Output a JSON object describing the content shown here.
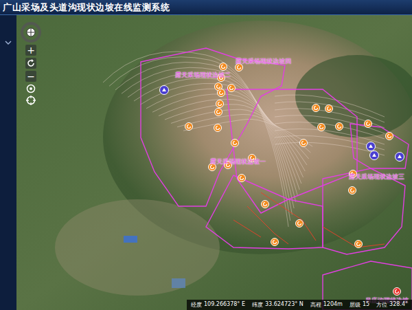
{
  "window": {
    "title": "广山采场及头道沟现状边坡在线监测系统"
  },
  "nav": {
    "zoom_in": "+",
    "zoom_out": "−"
  },
  "map": {
    "labels": [
      {
        "text": "露天采场现状边坡四"
      },
      {
        "text": "露天采场现状边坡二"
      },
      {
        "text": "露天采场现状边坡一"
      },
      {
        "text": "露天采场现状边坡三"
      },
      {
        "text": "吊庄沟现状边坡"
      }
    ],
    "pins": [
      {
        "kind": "monitor",
        "color": "#f28a1e"
      },
      {
        "kind": "monitor",
        "color": "#f28a1e"
      },
      {
        "kind": "monitor",
        "color": "#f28a1e"
      },
      {
        "kind": "monitor",
        "color": "#f28a1e"
      },
      {
        "kind": "monitor",
        "color": "#f28a1e"
      },
      {
        "kind": "monitor",
        "color": "#f28a1e"
      },
      {
        "kind": "monitor",
        "color": "#f28a1e"
      },
      {
        "kind": "monitor",
        "color": "#f28a1e"
      },
      {
        "kind": "monitor",
        "color": "#f28a1e"
      },
      {
        "kind": "monitor",
        "color": "#f28a1e"
      },
      {
        "kind": "monitor",
        "color": "#f28a1e"
      },
      {
        "kind": "monitor",
        "color": "#f28a1e"
      },
      {
        "kind": "monitor",
        "color": "#f28a1e"
      },
      {
        "kind": "monitor",
        "color": "#f28a1e"
      },
      {
        "kind": "monitor",
        "color": "#f28a1e"
      },
      {
        "kind": "monitor",
        "color": "#f28a1e"
      },
      {
        "kind": "monitor",
        "color": "#f28a1e"
      },
      {
        "kind": "monitor",
        "color": "#f28a1e"
      },
      {
        "kind": "monitor",
        "color": "#f28a1e"
      },
      {
        "kind": "monitor",
        "color": "#f28a1e"
      },
      {
        "kind": "monitor",
        "color": "#f28a1e"
      },
      {
        "kind": "monitor",
        "color": "#f28a1e"
      },
      {
        "kind": "monitor",
        "color": "#f28a1e"
      },
      {
        "kind": "monitor",
        "color": "#f28a1e"
      },
      {
        "kind": "monitor",
        "color": "#f28a1e"
      },
      {
        "kind": "monitor",
        "color": "#f28a1e"
      },
      {
        "kind": "monitor",
        "color": "#f28a1e"
      },
      {
        "kind": "monitor",
        "color": "#f28a1e"
      },
      {
        "kind": "station",
        "color": "#4a3fd0"
      },
      {
        "kind": "station",
        "color": "#4a3fd0"
      },
      {
        "kind": "station",
        "color": "#4a3fd0"
      },
      {
        "kind": "station",
        "color": "#4a3fd0"
      },
      {
        "kind": "alarm",
        "color": "#e8322a"
      }
    ]
  },
  "status_bar": [
    {
      "label": "经度",
      "value": "109.266378° E"
    },
    {
      "label": "纬度",
      "value": "33.624723° N"
    },
    {
      "label": "高程",
      "value": "1204m"
    },
    {
      "label": "层级",
      "value": "15"
    },
    {
      "label": "方位",
      "value": "328.4°"
    }
  ]
}
